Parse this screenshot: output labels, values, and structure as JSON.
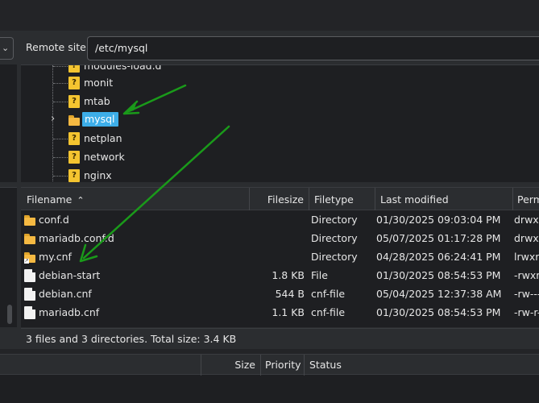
{
  "remote": {
    "label": "Remote site:",
    "path": "/etc/mysql"
  },
  "tree": {
    "items": [
      {
        "label": "modules-load.d",
        "icon": "question-folder-icon"
      },
      {
        "label": "monit",
        "icon": "question-folder-icon"
      },
      {
        "label": "mtab",
        "icon": "question-folder-icon"
      },
      {
        "label": "mysql",
        "icon": "folder-icon",
        "selected": true,
        "expandable": true
      },
      {
        "label": "netplan",
        "icon": "question-folder-icon"
      },
      {
        "label": "network",
        "icon": "question-folder-icon"
      },
      {
        "label": "nginx",
        "icon": "question-folder-icon"
      }
    ]
  },
  "filelist": {
    "columns": [
      "Filename",
      "Filesize",
      "Filetype",
      "Last modified",
      "Perm"
    ],
    "rows": [
      {
        "name": "conf.d",
        "size": "",
        "type": "Directory",
        "modified": "01/30/2025 09:03:04 PM",
        "perm": "drwxr",
        "icon": "folder-icon"
      },
      {
        "name": "mariadb.conf.d",
        "size": "",
        "type": "Directory",
        "modified": "05/07/2025 01:17:28 PM",
        "perm": "drwxr",
        "icon": "folder-icon"
      },
      {
        "name": "my.cnf",
        "size": "",
        "type": "Directory",
        "modified": "04/28/2025 06:24:41 PM",
        "perm": "lrwxrw",
        "icon": "folder-link-icon"
      },
      {
        "name": "debian-start",
        "size": "1.8 KB",
        "type": "File",
        "modified": "01/30/2025 08:54:53 PM",
        "perm": "-rwxr-",
        "icon": "file-icon"
      },
      {
        "name": "debian.cnf",
        "size": "544 B",
        "type": "cnf-file",
        "modified": "05/04/2025 12:37:38 AM",
        "perm": "-rw----",
        "icon": "file-icon"
      },
      {
        "name": "mariadb.cnf",
        "size": "1.1 KB",
        "type": "cnf-file",
        "modified": "01/30/2025 08:54:53 PM",
        "perm": "-rw-r-",
        "icon": "file-icon"
      }
    ]
  },
  "status": {
    "text": "3 files and 3 directories. Total size: 3.4 KB"
  },
  "queue": {
    "columns": [
      "Size",
      "Priority",
      "Status"
    ]
  },
  "colors": {
    "selection": "#3daee9",
    "arrow": "#1a9a1a",
    "folder": "#f5b942"
  }
}
